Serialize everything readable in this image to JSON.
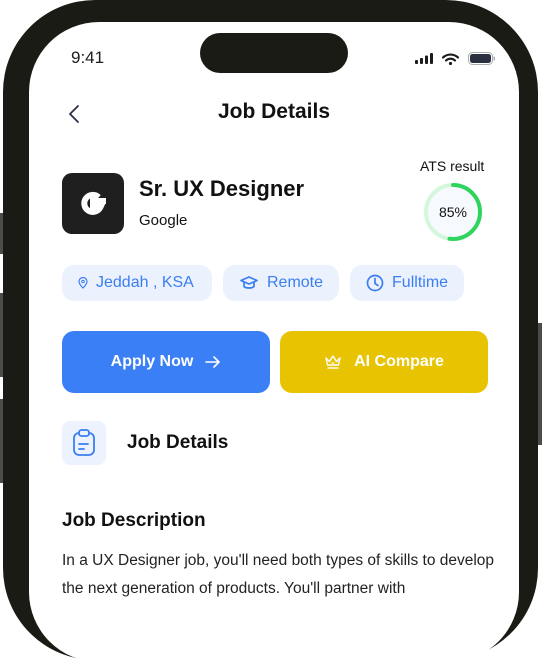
{
  "status_bar": {
    "time": "9:41",
    "icons": [
      "cellular-signal-icon",
      "wifi-icon",
      "battery-icon"
    ]
  },
  "header": {
    "title": "Job Details",
    "back_icon": "chevron-left-icon"
  },
  "job": {
    "title": "Sr. UX Designer",
    "company": "Google",
    "logo_letter": "G",
    "ats": {
      "label": "ATS result",
      "value_text": "85%",
      "percent": 85,
      "ring_fill_fraction": 0.52,
      "colors": {
        "track": "#d4f7dc",
        "fill": "#2fd45e",
        "inner": "#f6faff"
      }
    }
  },
  "tags": [
    {
      "icon": "location-pin-icon",
      "label": "Jeddah , KSA"
    },
    {
      "icon": "graduation-cap-icon",
      "label": "Remote"
    },
    {
      "icon": "clock-icon",
      "label": "Fulltime"
    }
  ],
  "actions": {
    "apply": {
      "label": "Apply Now",
      "icon": "arrow-right-icon",
      "color": "#3b7ff7"
    },
    "compare": {
      "label": "AI Compare",
      "icon": "crown-icon",
      "color": "#e8c302"
    }
  },
  "section": {
    "icon": "clipboard-icon",
    "label": "Job Details"
  },
  "description": {
    "title": "Job Description",
    "text": "In a UX Designer job, you'll need both types of skills to develop the next generation of products. You'll partner with"
  }
}
